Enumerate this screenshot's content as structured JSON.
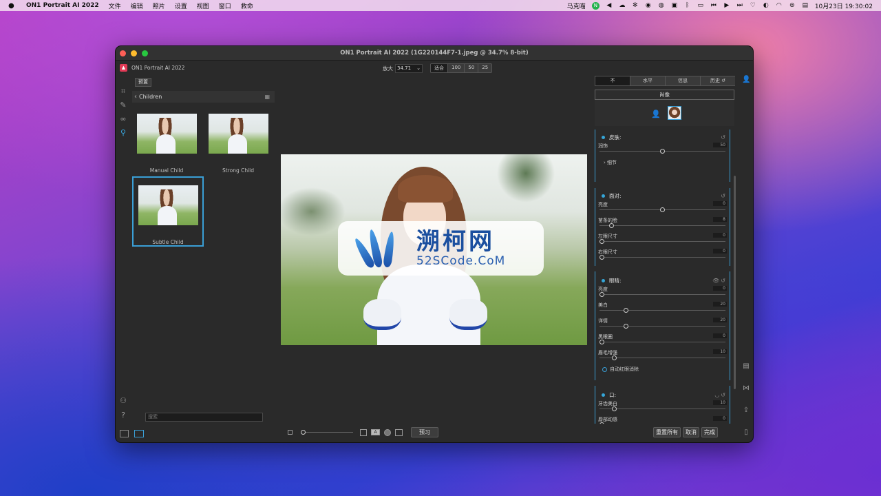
{
  "menubar": {
    "apple": "",
    "app_name": "ON1 Portrait AI 2022",
    "menus": [
      "文件",
      "编辑",
      "照片",
      "设置",
      "视图",
      "窗口",
      "救命"
    ],
    "user": "马克喵",
    "datetime": "10月23日  19:30:02"
  },
  "window": {
    "title": "ON1 Portrait AI 2022 (1G220144F7-1.jpeg @ 34.7% 8-bit)",
    "brand": "ON1 Portrait AI 2022"
  },
  "zoom": {
    "label": "放大",
    "value": "34.71",
    "fit": "适合",
    "opt_100": "100",
    "opt_50": "50",
    "opt_25": "25"
  },
  "browser": {
    "preset_tab": "预置",
    "breadcrumb": "Children",
    "thumbs": [
      {
        "label": "Manual Child"
      },
      {
        "label": "Strong Child"
      },
      {
        "label": "Subtle Child"
      }
    ],
    "search_placeholder": "搜索"
  },
  "watermark": {
    "cn": "溯柯网",
    "en": "52SCode.CoM"
  },
  "bottombar": {
    "preview": "预习",
    "reset_all": "重置所有",
    "cancel": "取消",
    "done": "完成",
    "a_label": "A"
  },
  "rpanel": {
    "tabs": [
      "不",
      "水平",
      "信息",
      "历史 ↺"
    ],
    "portrait": "肖像",
    "skin": {
      "title": "皮肤:",
      "rows": [
        {
          "label": "润饰",
          "value": "50",
          "level": 0.5
        }
      ],
      "details": "细节"
    },
    "face": {
      "title": "面对:",
      "rows": [
        {
          "label": "亮度",
          "value": "0",
          "level": 0.5
        },
        {
          "label": "苗条的脸",
          "value": "8",
          "level": 0.08
        },
        {
          "label": "左眼尺寸",
          "value": "0",
          "level": 0.0
        },
        {
          "label": "右眼尺寸",
          "value": "0",
          "level": 0.0
        }
      ]
    },
    "eyes": {
      "title": "眼睛:",
      "rows": [
        {
          "label": "亮度",
          "value": "0",
          "level": 0.0
        },
        {
          "label": "美白",
          "value": "20",
          "level": 0.2
        },
        {
          "label": "详情",
          "value": "20",
          "level": 0.2
        },
        {
          "label": "黑眼圈",
          "value": "0",
          "level": 0.0
        },
        {
          "label": "眉毛增强",
          "value": "10",
          "level": 0.1
        }
      ],
      "auto_redeye": "自动红眼消除"
    },
    "mouth": {
      "title": "口:",
      "rows": [
        {
          "label": "牙齿美白",
          "value": "10",
          "level": 0.1
        },
        {
          "label": "唇部动感",
          "value": "0",
          "level": 0.0
        }
      ]
    }
  }
}
